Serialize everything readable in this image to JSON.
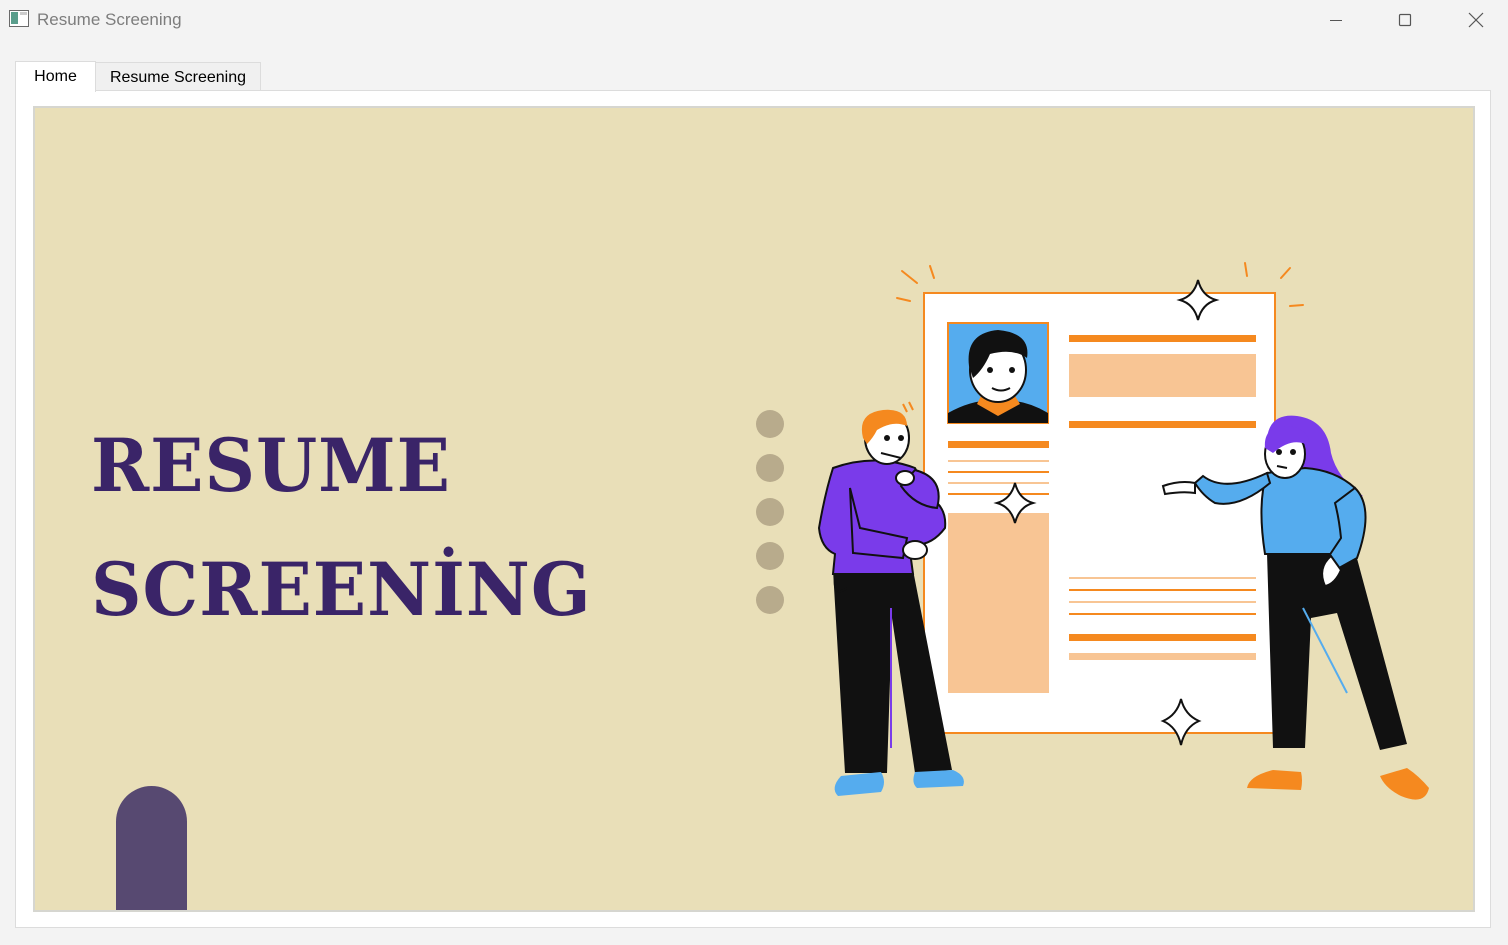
{
  "window": {
    "title": "Resume Screening"
  },
  "tabs": [
    {
      "label": "Home",
      "selected": true
    },
    {
      "label": "Resume Screening",
      "selected": false
    }
  ],
  "home": {
    "headline_line1": "RESUME",
    "headline_line2": "SCREENİNG"
  },
  "colors": {
    "background": "#e9dfb8",
    "headline": "#3a2468",
    "arch": "#574971",
    "accent_orange": "#f5891f",
    "accent_peach": "#f8c594",
    "accent_blue": "#55acee",
    "accent_purple": "#7a3bea",
    "dots": "#b8ab8c"
  },
  "icons": {
    "minimize": "minimize-icon",
    "maximize": "maximize-icon",
    "close": "close-icon",
    "app": "app-window-icon"
  }
}
